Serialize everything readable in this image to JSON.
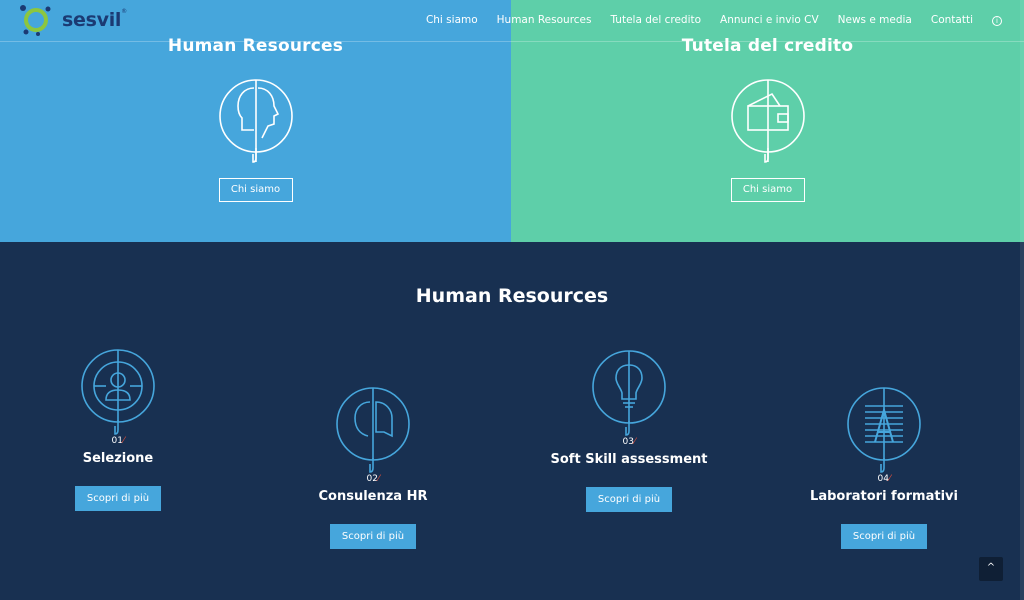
{
  "nav": {
    "logo_text": "sesvil",
    "logo_mark": "®",
    "items": [
      {
        "label": "Chi siamo"
      },
      {
        "label": "Human Resources"
      },
      {
        "label": "Tutela del credito"
      },
      {
        "label": "Annunci e invio CV"
      },
      {
        "label": "News e media"
      },
      {
        "label": "Contatti"
      }
    ],
    "info_icon": "info-icon"
  },
  "hero": {
    "left": {
      "title": "Human Resources",
      "button": "Chi siamo",
      "icon": "head-silhouette-icon",
      "color": "#46a6dc"
    },
    "right": {
      "title": "Tutela del credito",
      "button": "Chi siamo",
      "icon": "wallet-icon",
      "color": "#5ecfa9"
    }
  },
  "section": {
    "title": "Human Resources",
    "background": "#183051",
    "services": [
      {
        "number": "01",
        "title": "Selezione",
        "button": "Scopri di più",
        "icon": "person-search-icon"
      },
      {
        "number": "02",
        "title": "Consulenza HR",
        "button": "Scopri di più",
        "icon": "speech-bubble-icon"
      },
      {
        "number": "03",
        "title": "Soft Skill assessment",
        "button": "Scopri di più",
        "icon": "lightbulb-icon"
      },
      {
        "number": "04",
        "title": "Laboratori formativi",
        "button": "Scopri di più",
        "icon": "document-text-icon"
      }
    ]
  },
  "back_to_top": "^"
}
